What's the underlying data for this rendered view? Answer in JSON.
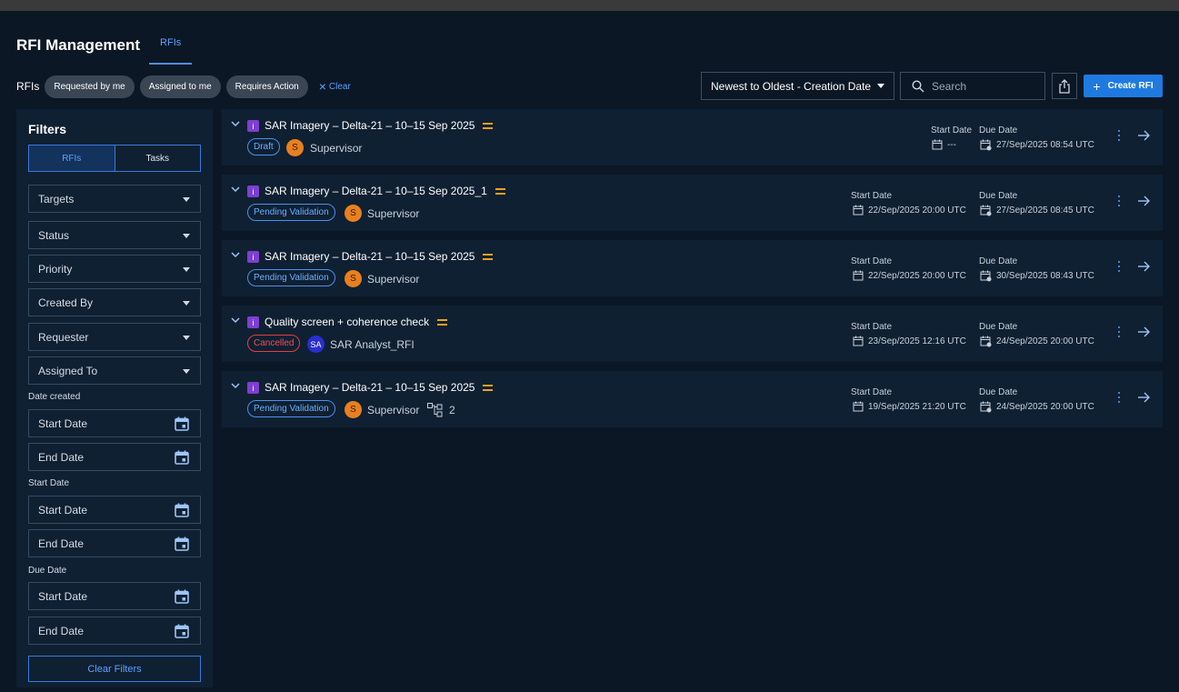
{
  "header": {
    "title": "RFI Management",
    "tab": "RFIs"
  },
  "filterbar": {
    "label": "RFIs",
    "chips": [
      "Requested by me",
      "Assigned to me",
      "Requires Action"
    ],
    "clear": "Clear"
  },
  "toolbar": {
    "sort": "Newest to Oldest - Creation Date",
    "search_placeholder": "Search",
    "create": "Create RFI"
  },
  "sidebar": {
    "title": "Filters",
    "toggle": [
      "RFIs",
      "Tasks"
    ],
    "dropdowns": [
      "Targets",
      "Status",
      "Priority",
      "Created By",
      "Requester",
      "Assigned To"
    ],
    "groups": {
      "date_created": "Date created",
      "start_date": "Start Date",
      "due_date": "Due Date"
    },
    "start_placeholder": "Start Date",
    "end_placeholder": "End Date",
    "clear_filters": "Clear Filters"
  },
  "labels": {
    "start": "Start Date",
    "due": "Due Date"
  },
  "rfis": [
    {
      "title": "SAR Imagery – Delta-21 – 10–15 Sep 2025",
      "status": "Draft",
      "avatar": "S",
      "assignee": "Supervisor",
      "start": "---",
      "due": "27/Sep/2025 08:54 UTC"
    },
    {
      "title": "SAR Imagery – Delta-21 – 10–15 Sep 2025_1",
      "status": "Pending Validation",
      "avatar": "S",
      "assignee": "Supervisor",
      "start": "22/Sep/2025 20:00 UTC",
      "due": "27/Sep/2025 08:45 UTC"
    },
    {
      "title": "SAR Imagery – Delta-21 – 10–15 Sep 2025",
      "status": "Pending Validation",
      "avatar": "S",
      "assignee": "Supervisor",
      "start": "22/Sep/2025 20:00 UTC",
      "due": "30/Sep/2025 08:43 UTC"
    },
    {
      "title": "Quality screen + coherence check",
      "status": "Cancelled",
      "avatar": "SA",
      "assignee": "SAR Analyst_RFI",
      "start": "23/Sep/2025 12:16 UTC",
      "due": "24/Sep/2025 20:00 UTC"
    },
    {
      "title": "SAR Imagery – Delta-21 – 10–15 Sep 2025",
      "status": "Pending Validation",
      "avatar": "S",
      "assignee": "Supervisor",
      "subtasks": "2",
      "start": "19/Sep/2025 21:20 UTC",
      "due": "24/Sep/2025 20:00 UTC"
    }
  ],
  "colors": {
    "accent": "#1f7ae0",
    "priority": "#f0a020",
    "cancelled": "#f05050",
    "badge": "#7d3fd0"
  }
}
